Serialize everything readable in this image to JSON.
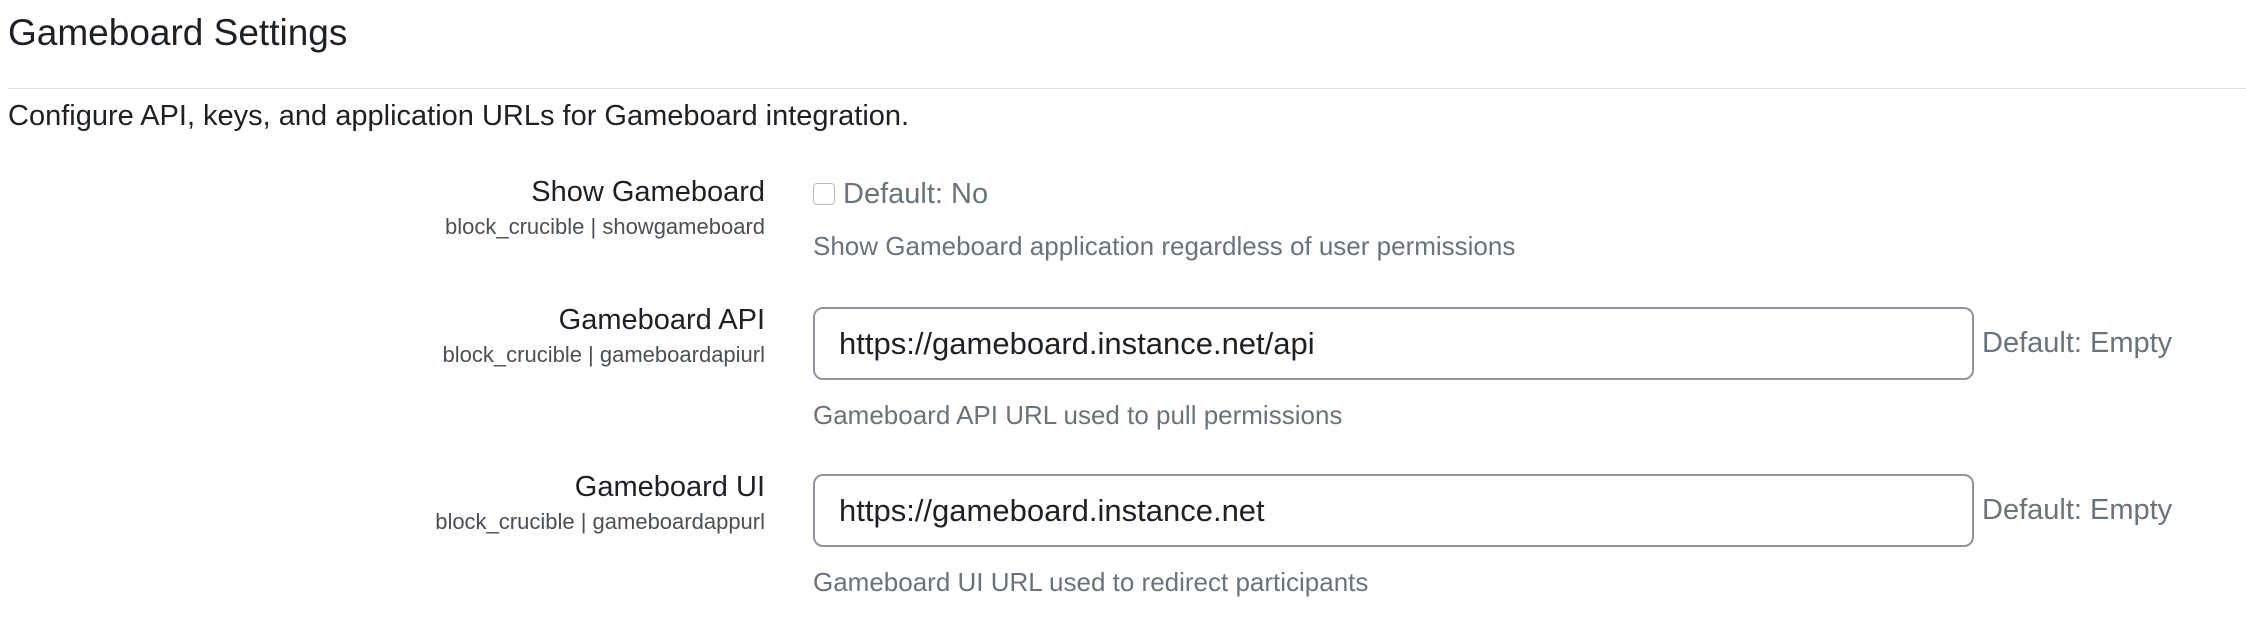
{
  "section": {
    "title": "Gameboard Settings",
    "description": "Configure API, keys, and application URLs for Gameboard integration."
  },
  "settings": [
    {
      "label": "Show Gameboard",
      "key": "block_crucible | showgameboard",
      "type": "checkbox",
      "checked": false,
      "default": "Default: No",
      "help": "Show Gameboard application regardless of user permissions"
    },
    {
      "label": "Gameboard API",
      "key": "block_crucible | gameboardapiurl",
      "type": "text",
      "value": "https://gameboard.instance.net/api",
      "default": "Default: Empty",
      "help": "Gameboard API URL used to pull permissions"
    },
    {
      "label": "Gameboard UI",
      "key": "block_crucible | gameboardappurl",
      "type": "text",
      "value": "https://gameboard.instance.net",
      "default": "Default: Empty",
      "help": "Gameboard UI URL used to redirect participants"
    }
  ]
}
